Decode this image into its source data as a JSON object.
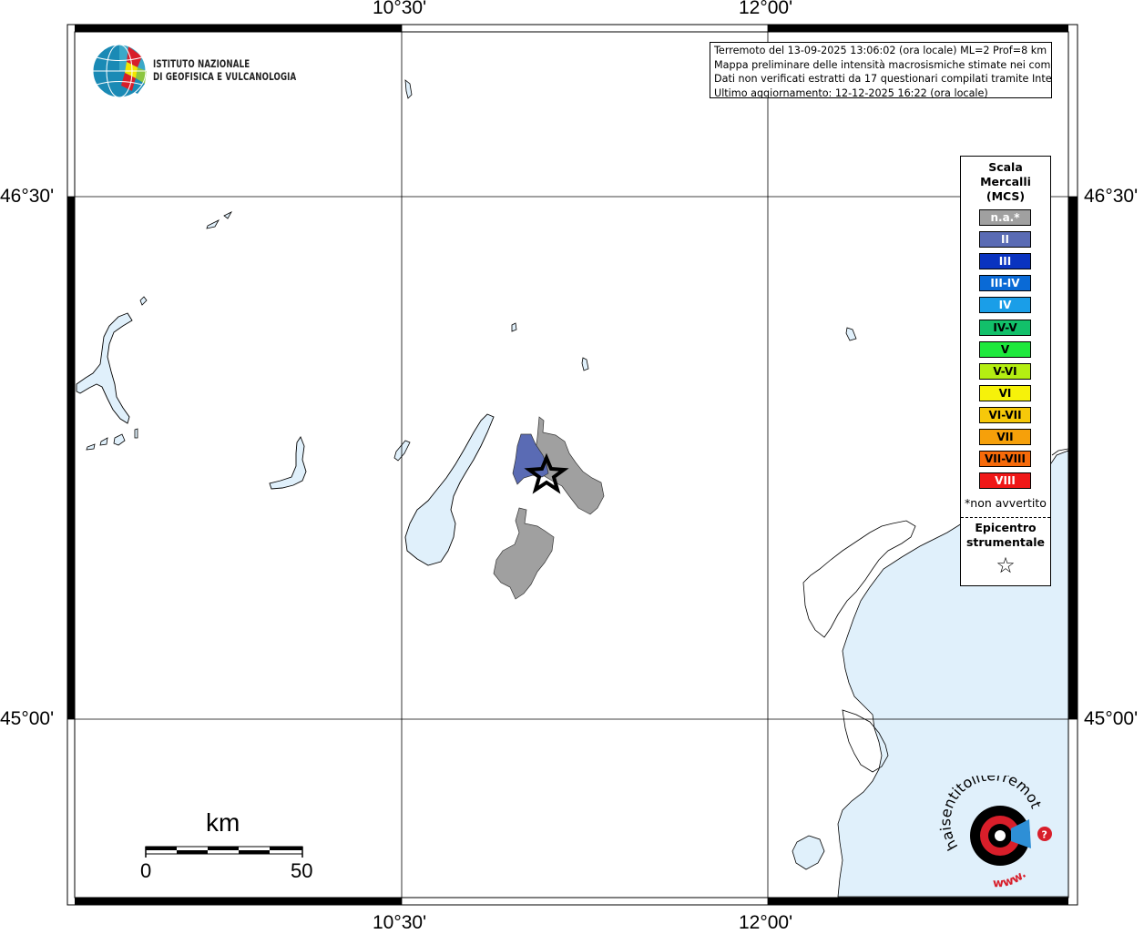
{
  "axes": {
    "top_lon_labels": [
      "10°30'",
      "12°00'"
    ],
    "bottom_lon_labels": [
      "10°30'",
      "12°00'"
    ],
    "left_lat_labels": [
      "46°30'",
      "45°00'"
    ],
    "right_lat_labels": [
      "46°30'",
      "45°00'"
    ]
  },
  "institute": {
    "line1": "ISTITUTO NAZIONALE",
    "line2": "DI GEOFISICA E VULCANOLOGIA"
  },
  "info": {
    "line1": "Terremoto del 13-09-2025 13:06:02 (ora locale) ML=2 Prof=8 km",
    "line2": "Mappa preliminare delle intensità macrosismiche stimate nei comuni",
    "line3": "Dati non verificati estratti da 17 questionari compilati tramite Internet.",
    "line4": "Ultimo aggiornamento: 12-12-2025 16:22 (ora locale)"
  },
  "legend": {
    "title_line1": "Scala",
    "title_line2": "Mercalli",
    "title_line3": "(MCS)",
    "classes": [
      {
        "label": "n.a.*",
        "color": "#a0a0a0",
        "text_color": "#ffffff"
      },
      {
        "label": "II",
        "color": "#5a6bb4",
        "text_color": "#ffffff"
      },
      {
        "label": "III",
        "color": "#0a33c0",
        "text_color": "#ffffff"
      },
      {
        "label": "III-IV",
        "color": "#0a6ad6",
        "text_color": "#ffffff"
      },
      {
        "label": "IV",
        "color": "#1a9ee8",
        "text_color": "#ffffff"
      },
      {
        "label": "IV-V",
        "color": "#12c06a",
        "text_color": "#000000"
      },
      {
        "label": "V",
        "color": "#1ee83c",
        "text_color": "#000000"
      },
      {
        "label": "V-VI",
        "color": "#b4ee12",
        "text_color": "#000000"
      },
      {
        "label": "VI",
        "color": "#f6f20a",
        "text_color": "#000000"
      },
      {
        "label": "VI-VII",
        "color": "#f6c80a",
        "text_color": "#000000"
      },
      {
        "label": "VII",
        "color": "#f6a00a",
        "text_color": "#000000"
      },
      {
        "label": "VII-VIII",
        "color": "#f66a0a",
        "text_color": "#000000"
      },
      {
        "label": "VIII",
        "color": "#f01818",
        "text_color": "#ffffff"
      }
    ],
    "note": "*non avvertito",
    "epicenter_line1": "Epicentro",
    "epicenter_line2": "strumentale",
    "epicenter_symbol": "☆"
  },
  "scalebar": {
    "unit": "km",
    "min_label": "0",
    "max_label": "50"
  },
  "colors": {
    "water": "#e0f0fb",
    "not_felt": "#a0a0a0",
    "intensity_II": "#5a6bb4"
  },
  "watermark": {
    "text": "haisentitoilterremoto.it",
    "www": "www."
  }
}
